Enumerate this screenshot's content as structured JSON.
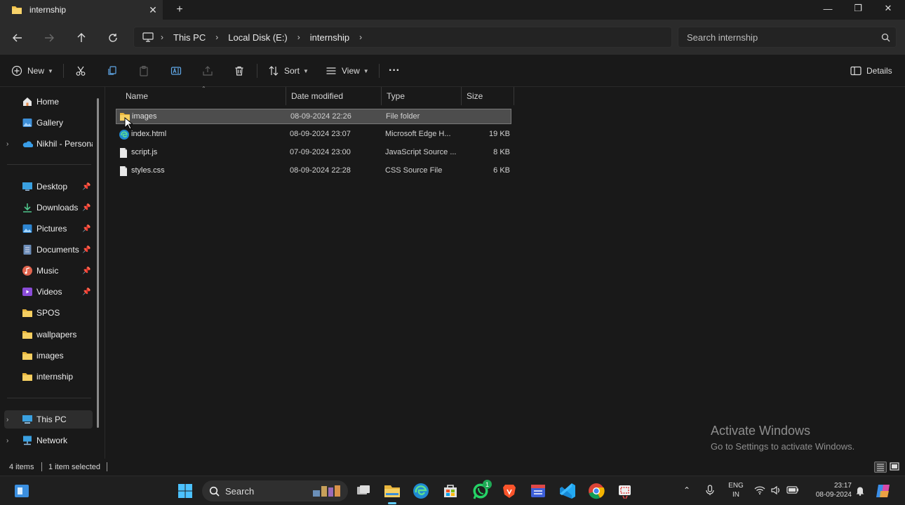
{
  "window": {
    "tab_title": "internship",
    "minimize_glyph": "—",
    "maximize_glyph": "❐",
    "close_glyph": "✕"
  },
  "address": {
    "crumbs": [
      "This PC",
      "Local Disk (E:)",
      "internship"
    ],
    "search_placeholder": "Search internship"
  },
  "toolbar": {
    "new_label": "New",
    "sort_label": "Sort",
    "view_label": "View",
    "more_label": "···",
    "details_label": "Details"
  },
  "sidebar": {
    "items": [
      {
        "label": "Home",
        "icon": "home-icon"
      },
      {
        "label": "Gallery",
        "icon": "gallery-icon"
      },
      {
        "label": "Nikhil - Personal",
        "icon": "onedrive-icon"
      },
      {
        "label": "Desktop",
        "icon": "desktop-icon"
      },
      {
        "label": "Downloads",
        "icon": "downloads-icon"
      },
      {
        "label": "Pictures",
        "icon": "pictures-icon"
      },
      {
        "label": "Documents",
        "icon": "documents-icon"
      },
      {
        "label": "Music",
        "icon": "music-icon"
      },
      {
        "label": "Videos",
        "icon": "videos-icon"
      },
      {
        "label": "SPOS",
        "icon": "folder-icon"
      },
      {
        "label": "wallpapers",
        "icon": "folder-icon"
      },
      {
        "label": "images",
        "icon": "folder-icon"
      },
      {
        "label": "internship",
        "icon": "folder-icon"
      },
      {
        "label": "This PC",
        "icon": "pc-icon"
      },
      {
        "label": "Network",
        "icon": "network-icon"
      }
    ]
  },
  "files": {
    "columns": [
      "Name",
      "Date modified",
      "Type",
      "Size"
    ],
    "rows": [
      {
        "name": "images",
        "date": "08-09-2024 22:26",
        "type": "File folder",
        "size": "",
        "icon": "folder-icon"
      },
      {
        "name": "index.html",
        "date": "08-09-2024 23:07",
        "type": "Microsoft Edge H...",
        "size": "19 KB",
        "icon": "edge-icon"
      },
      {
        "name": "script.js",
        "date": "07-09-2024 23:00",
        "type": "JavaScript Source ...",
        "size": "8 KB",
        "icon": "file-icon"
      },
      {
        "name": "styles.css",
        "date": "08-09-2024 22:28",
        "type": "CSS Source File",
        "size": "6 KB",
        "icon": "file-icon"
      }
    ]
  },
  "watermark": {
    "line1": "Activate Windows",
    "line2": "Go to Settings to activate Windows."
  },
  "status": {
    "items_count": "4 items",
    "selected": "1 item selected"
  },
  "taskbar": {
    "search_label": "Search",
    "lang": "ENG",
    "region": "IN",
    "time": "23:17",
    "date": "08-09-2024",
    "whatsapp_badge": "1"
  },
  "colors": {
    "accent": "#60cdff",
    "folder": "#f2c34c",
    "background": "#191919"
  }
}
